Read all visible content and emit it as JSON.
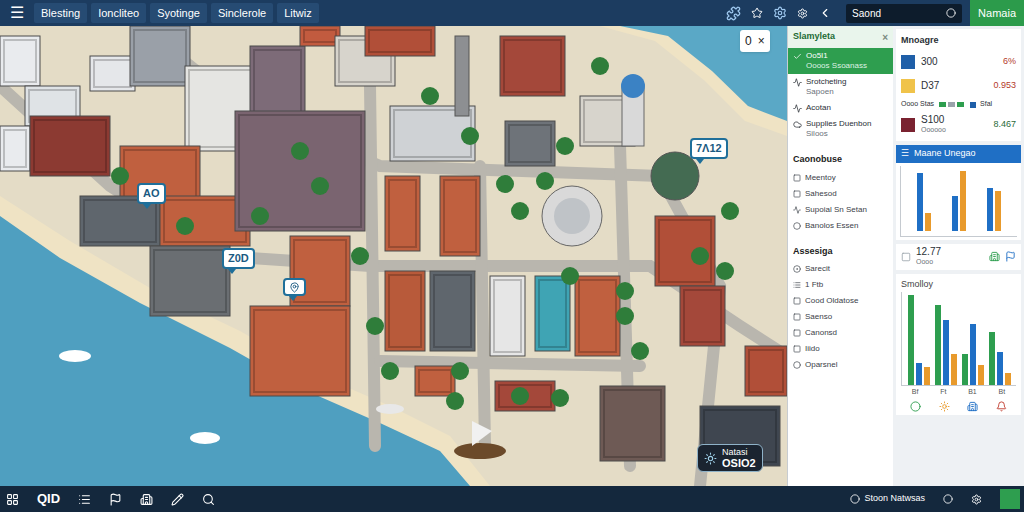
{
  "topbar": {
    "menu_icon": "☰",
    "tabs": [
      {
        "label": "Blesting"
      },
      {
        "label": "Ioncliteo"
      },
      {
        "label": "Syotinge"
      },
      {
        "label": "Sinclerole"
      },
      {
        "label": "Litwiz"
      }
    ],
    "search": {
      "value": "Saond"
    },
    "button": "Namaia"
  },
  "map": {
    "controls": {
      "value": "0",
      "close": "×"
    },
    "pins": [
      {
        "kind": "text",
        "label": "7Λ12"
      },
      {
        "kind": "text",
        "label": "AO"
      },
      {
        "kind": "text",
        "label": "Z0D"
      },
      {
        "kind": "icon",
        "label": ""
      }
    ],
    "info": {
      "title": "Natasi",
      "value": "OSIO2"
    }
  },
  "tool_panel": {
    "title": "Slamyleta",
    "close": "×",
    "items": [
      {
        "label": "Oo5I1",
        "sub": "Oooos Ssoanass",
        "selected": true
      },
      {
        "label": "Srotcheting",
        "sub": "Sapoen",
        "selected": false
      },
      {
        "label": "Acotan",
        "sub": "",
        "selected": false
      },
      {
        "label": "Supplies Duenbon",
        "sub": "Siloos",
        "selected": false
      }
    ],
    "sections": [
      {
        "title": "Caonobuse",
        "items": [
          "Meentoy",
          "Sahesod",
          "Supoial Sn Setan",
          "Banolos Essen"
        ]
      },
      {
        "title": "Assesiga",
        "items": [
          "Sarecit",
          "1 Ftb",
          "Cood Oldatose",
          "Saenso",
          "Canonsd",
          "Iiido",
          "Oparsnel"
        ]
      }
    ]
  },
  "stats": {
    "title": "Mnoagre",
    "rows": [
      {
        "value": "300",
        "sub": "",
        "change": "6%",
        "color": "#1f5fa8"
      },
      {
        "value": "D37",
        "sub": "",
        "change": "0.953",
        "color": "#f0c34a"
      },
      {
        "value": "S100",
        "sub": "Oooooo",
        "change": "8.467",
        "color": "#7a2230"
      }
    ],
    "legend": {
      "label": "Oooo Stas",
      "end": "Sfal"
    },
    "usage_chart": {
      "title": "Maane Unegao",
      "menu": "☰",
      "series": [
        {
          "color": "#1f6fc5",
          "values": [
            40,
            24,
            30
          ]
        },
        {
          "color": "#e89a2c",
          "values": [
            12,
            42,
            28
          ]
        }
      ]
    },
    "summary": {
      "value": "12.77",
      "sub": "Oooo"
    },
    "smolloy_chart": {
      "title": "Smolloy",
      "ticks": [
        "Bf",
        "Ft",
        "B1",
        "Bt"
      ],
      "series": [
        {
          "color": "#2e9e4f",
          "values": [
            88,
            78,
            30,
            52
          ]
        },
        {
          "color": "#1f6fc5",
          "values": [
            22,
            64,
            60,
            32
          ]
        },
        {
          "color": "#e89a2c",
          "values": [
            18,
            30,
            20,
            12
          ]
        }
      ]
    }
  },
  "bottom_bar": {
    "label": "QID",
    "status": "Stoon Natwsas"
  }
}
